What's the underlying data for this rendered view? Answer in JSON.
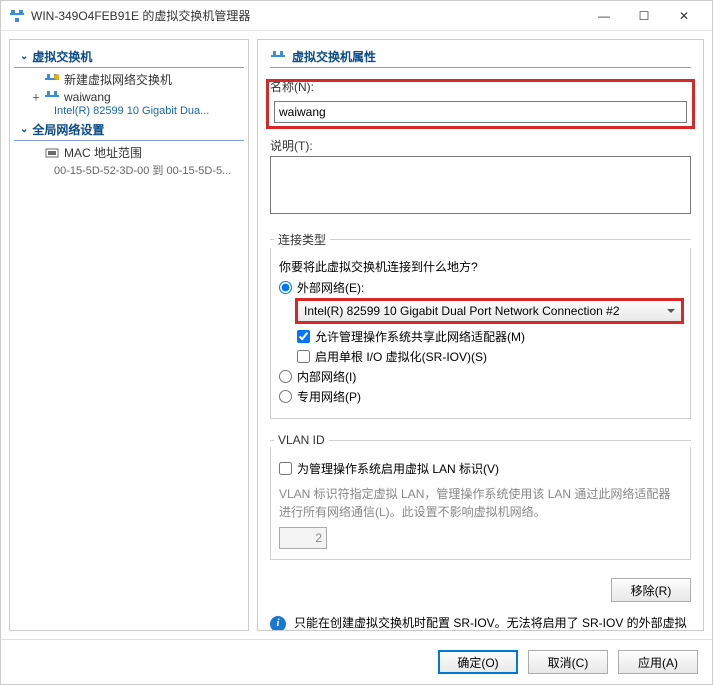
{
  "window": {
    "title": "WIN-349O4FEB91E 的虚拟交换机管理器",
    "min": "—",
    "max": "☐",
    "close": "✕"
  },
  "sidebar": {
    "section1": {
      "label": "虚拟交换机"
    },
    "item_new": {
      "label": "新建虚拟网络交换机"
    },
    "item_waiwang": {
      "label": "waiwang",
      "sub": "Intel(R) 82599 10 Gigabit Dua..."
    },
    "section2": {
      "label": "全局网络设置"
    },
    "item_mac": {
      "label": "MAC 地址范围",
      "sub": "00-15-5D-52-3D-00 到 00-15-5D-5..."
    }
  },
  "main": {
    "header": "虚拟交换机属性",
    "name_label": "名称(N):",
    "name_value": "waiwang",
    "desc_label": "说明(T):",
    "desc_value": "",
    "conn_group": "连接类型",
    "conn_question": "你要将此虚拟交换机连接到什么地方?",
    "radio_external": "外部网络(E):",
    "adapter": "Intel(R) 82599 10 Gigabit Dual Port Network Connection #2",
    "cb_allow_mgmt": "允许管理操作系统共享此网络适配器(M)",
    "cb_sriov": "启用单根 I/O 虚拟化(SR-IOV)(S)",
    "radio_internal": "内部网络(I)",
    "radio_private": "专用网络(P)",
    "vlan_group": "VLAN ID",
    "cb_vlan": "为管理操作系统启用虚拟 LAN 标识(V)",
    "vlan_note": "VLAN 标识符指定虚拟 LAN，管理操作系统使用该 LAN 通过此网络适配器进行所有网络通信(L)。此设置不影响虚拟机网络。",
    "vlan_value": "2",
    "btn_remove": "移除(R)",
    "info_text": "只能在创建虚拟交换机时配置 SR-IOV。无法将启用了 SR-IOV 的外部虚拟交换机转换为内部或专用交换机。"
  },
  "footer": {
    "ok": "确定(O)",
    "cancel": "取消(C)",
    "apply": "应用(A)"
  }
}
